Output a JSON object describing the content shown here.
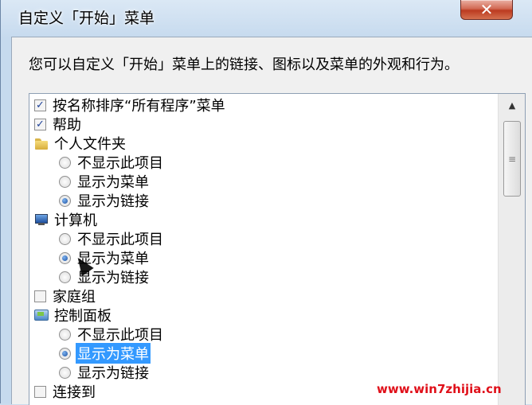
{
  "window": {
    "title": "自定义「开始」菜单",
    "close_label": "✕"
  },
  "description": "您可以自定义「开始」菜单上的链接、图标以及菜单的外观和行为。",
  "list_items": [
    {
      "type": "checkbox",
      "checked": true,
      "label": "按名称排序“所有程序”菜单"
    },
    {
      "type": "checkbox",
      "checked": true,
      "label": "帮助"
    },
    {
      "type": "group",
      "icon": "folder-icon",
      "label": "个人文件夹"
    },
    {
      "type": "radio",
      "checked": false,
      "label": "不显示此项目"
    },
    {
      "type": "radio",
      "checked": false,
      "label": "显示为菜单"
    },
    {
      "type": "radio",
      "checked": true,
      "label": "显示为链接"
    },
    {
      "type": "group",
      "icon": "computer-icon",
      "label": "计算机"
    },
    {
      "type": "radio",
      "checked": false,
      "label": "不显示此项目"
    },
    {
      "type": "radio",
      "checked": true,
      "label": "显示为菜单"
    },
    {
      "type": "radio",
      "checked": false,
      "label": "显示为链接"
    },
    {
      "type": "checkbox",
      "checked": false,
      "label": "家庭组"
    },
    {
      "type": "group",
      "icon": "control-panel-icon",
      "label": "控制面板"
    },
    {
      "type": "radio",
      "checked": false,
      "label": "不显示此项目"
    },
    {
      "type": "radio",
      "checked": true,
      "selected": true,
      "label": "显示为菜单"
    },
    {
      "type": "radio",
      "checked": false,
      "label": "显示为链接"
    },
    {
      "type": "checkbox",
      "checked": false,
      "label": "连接到"
    }
  ],
  "watermark": "www.win7zhijia.cn",
  "colors": {
    "selection": "#3399ff",
    "watermark": "#e0101a"
  }
}
